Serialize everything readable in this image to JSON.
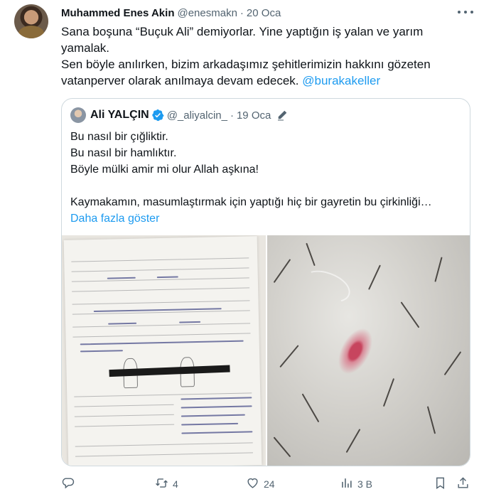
{
  "tweet": {
    "author_name": "Muhammed Enes Akin",
    "author_handle": "@enesmakn",
    "separator": "·",
    "date": "20 Oca",
    "text_lines": [
      "Sana boşuna “Buçuk Ali” demiyorlar. Yine yaptığın iş yalan ve yarım",
      "yamalak.",
      "Sen böyle anılırken, bizim arkadaşımız şehitlerimizin hakkını gözeten"
    ],
    "text_last_line": "vatanperver olarak anılmaya devam edecek.",
    "mention": "@burakakeller"
  },
  "quoted": {
    "author_name": "Ali YALÇIN",
    "author_handle": "@_aliyalcin_",
    "separator": "·",
    "date": "19 Oca",
    "text_lines": [
      "Bu nasıl bir çığliktir.",
      "Bu nasıl bir hamlıktır.",
      "Böyle mülki amir mi olur Allah aşkına!",
      "",
      "Kaymakamın, masumlaştırmak için yaptığı hiç bir gayretin bu çirkinliği…"
    ],
    "show_more": "Daha fazla göster"
  },
  "actions": {
    "reply_count": "",
    "retweet_count": "4",
    "like_count": "24",
    "views_count": "3 B"
  },
  "icons": {
    "more": "more-dots-icon",
    "verified": "verified-badge-icon",
    "edit": "edited-pen-icon",
    "reply": "reply-icon",
    "retweet": "retweet-icon",
    "like": "heart-icon",
    "views": "views-chart-icon",
    "bookmark": "bookmark-icon",
    "share": "share-icon"
  },
  "colors": {
    "text": "#0f1419",
    "muted": "#536471",
    "accent": "#1d9bf0",
    "border": "#cfd9de"
  }
}
